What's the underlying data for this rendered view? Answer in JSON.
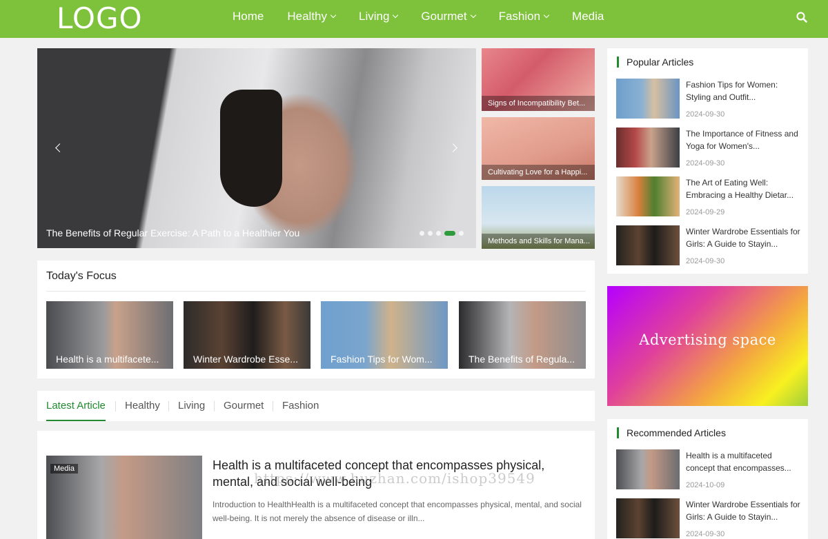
{
  "header": {
    "logo": "LOGO",
    "nav": [
      {
        "label": "Home",
        "dropdown": false
      },
      {
        "label": "Healthy",
        "dropdown": true
      },
      {
        "label": "Living",
        "dropdown": true
      },
      {
        "label": "Gourmet",
        "dropdown": true
      },
      {
        "label": "Fashion",
        "dropdown": true
      },
      {
        "label": "Media",
        "dropdown": false
      }
    ],
    "search_icon": "search-icon",
    "color": "#7dc23a"
  },
  "hero": {
    "title": "The Benefits of Regular Exercise: A Path to a Healthier You",
    "slide_count": 5,
    "active_slide": 4
  },
  "side_thumbs": [
    {
      "caption": "Signs of Incompatibility Bet..."
    },
    {
      "caption": "Cultivating Love for a Happi..."
    },
    {
      "caption": "Methods and Skills for Mana..."
    }
  ],
  "focus": {
    "title": "Today's Focus",
    "cards": [
      {
        "caption": "Health is a multifacete..."
      },
      {
        "caption": "Winter Wardrobe Esse..."
      },
      {
        "caption": "Fashion Tips for Wom..."
      },
      {
        "caption": "The Benefits of Regula..."
      }
    ]
  },
  "tabs": {
    "items": [
      "Latest Article",
      "Healthy",
      "Living",
      "Gourmet",
      "Fashion"
    ],
    "active": "Latest Article",
    "accent": "#1f8a2e"
  },
  "article": {
    "badge": "Media",
    "title": "Health is a multifaceted concept that encompasses physical, mental, and social well-being",
    "excerpt": "Introduction to HealthHealth is a multifaceted concept that encompasses physical, mental, and social well-being. It is not merely the absence of disease or illn..."
  },
  "popular": {
    "title": "Popular Articles",
    "items": [
      {
        "title": "Fashion Tips for Women: Styling and Outfit...",
        "date": "2024-09-30"
      },
      {
        "title": "The Importance of Fitness and Yoga for Women's...",
        "date": "2024-09-30"
      },
      {
        "title": "The Art of Eating Well: Embracing a Healthy Dietar...",
        "date": "2024-09-29"
      },
      {
        "title": "Winter Wardrobe Essentials for Girls: A Guide to Stayin...",
        "date": "2024-09-30"
      }
    ]
  },
  "ad": {
    "label": "Advertising space"
  },
  "recommended": {
    "title": "Recommended Articles",
    "items": [
      {
        "title": "Health is a multifaceted concept that encompasses...",
        "date": "2024-10-09"
      },
      {
        "title": "Winter Wardrobe Essentials for Girls: A Guide to Stayin...",
        "date": "2024-09-30"
      }
    ]
  },
  "watermark": "https://www.huzhan.com/ishop39549"
}
